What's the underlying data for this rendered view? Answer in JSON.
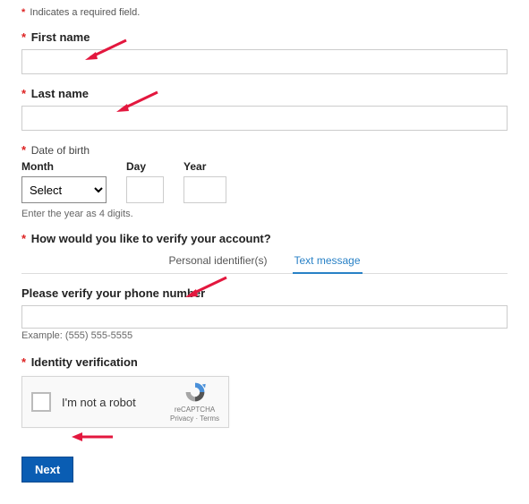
{
  "required_note": "Indicates a required field.",
  "first_name": {
    "label": "First name",
    "value": ""
  },
  "last_name": {
    "label": "Last name",
    "value": ""
  },
  "dob": {
    "label": "Date of birth",
    "month_label": "Month",
    "day_label": "Day",
    "year_label": "Year",
    "month_placeholder": "Select",
    "hint": "Enter the year as 4 digits."
  },
  "verify_method": {
    "label": "How would you like to verify your account?",
    "tab_personal": "Personal identifier(s)",
    "tab_text": "Text message"
  },
  "phone": {
    "label": "Please verify your phone number",
    "value": "",
    "example": "Example: (555) 555-5555"
  },
  "identity": {
    "label": "Identity verification",
    "recaptcha_text": "I'm not a robot",
    "recaptcha_brand": "reCAPTCHA",
    "recaptcha_links": "Privacy · Terms"
  },
  "next_button": "Next"
}
